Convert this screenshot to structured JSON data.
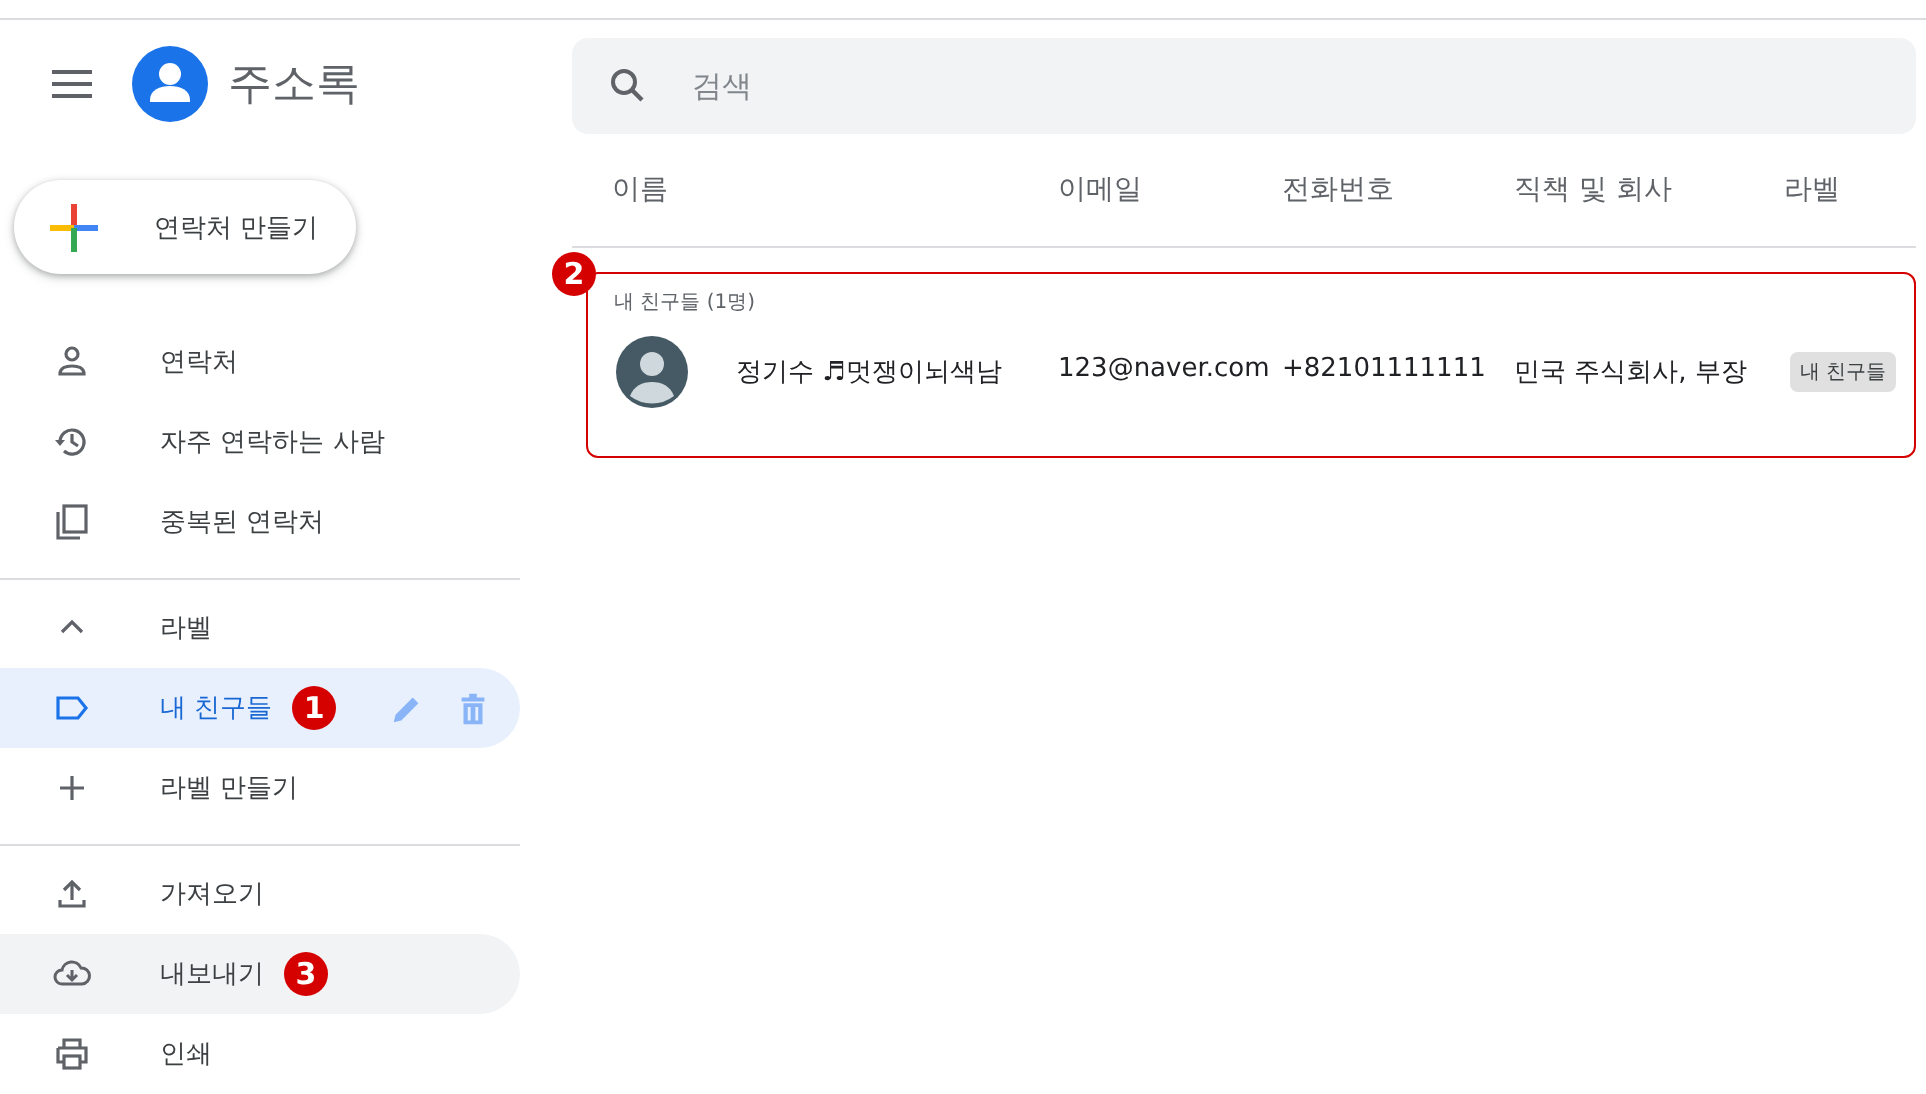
{
  "app": {
    "title": "주소록"
  },
  "create_button": {
    "label": "연락처 만들기"
  },
  "nav": [
    {
      "label": "연락처",
      "kind": "person",
      "selected": false
    },
    {
      "label": "자주 연락하는 사람",
      "kind": "history",
      "selected": false
    },
    {
      "label": "중복된 연락처",
      "kind": "copy",
      "selected": false
    }
  ],
  "labels_section": {
    "label": "라벨",
    "expanded": true,
    "items": [
      {
        "label": "내 친구들",
        "selected": true,
        "marker": "1"
      }
    ],
    "create_label": "라벨 만들기"
  },
  "tools": [
    {
      "label": "가져오기",
      "kind": "upload",
      "hovered": false
    },
    {
      "label": "내보내기",
      "kind": "export",
      "hovered": true,
      "marker": "3"
    },
    {
      "label": "인쇄",
      "kind": "print",
      "hovered": false
    }
  ],
  "search": {
    "placeholder": "검색"
  },
  "columns": [
    "이름",
    "이메일",
    "전화번호",
    "직책 및 회사",
    "라벨"
  ],
  "group": {
    "title": "내 친구들 (1명)",
    "marker": "2",
    "rows": [
      {
        "name": "정기수 ♬멋쟁이뇌색남",
        "email": "123@naver.com",
        "phone": "+82101111111",
        "job": "민국 주식회사, 부장",
        "label": "내 친구들"
      }
    ]
  }
}
